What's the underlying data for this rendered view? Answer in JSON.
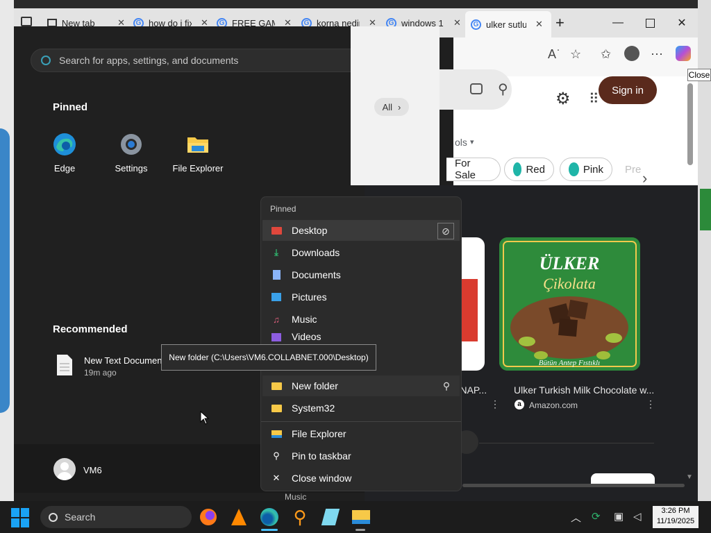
{
  "browser": {
    "tabs": [
      {
        "title": "New tab",
        "favicon": "newtab-icon"
      },
      {
        "title": "how do i fix",
        "favicon": "google-icon"
      },
      {
        "title": "FREE GAME",
        "favicon": "google-icon"
      },
      {
        "title": "korna nedir",
        "favicon": "google-icon"
      },
      {
        "title": "windows 1",
        "favicon": "google-icon"
      },
      {
        "title": "ulker sutlu",
        "favicon": "google-icon",
        "active": true
      }
    ],
    "close_tooltip": "Close"
  },
  "search_page": {
    "filter_all": "All",
    "tools_label": "ols",
    "signin_label": "Sign in",
    "chips": [
      {
        "label": "For Sale"
      },
      {
        "label": "Red",
        "color": "#1fb5a8"
      },
      {
        "label": "Pink",
        "color": "#1fb5a8"
      },
      {
        "label": "Pre"
      }
    ],
    "results": [
      {
        "caption": "A NAP...",
        "source": ""
      },
      {
        "caption": "Ulker Turkish Milk Chocolate w...",
        "source": "Amazon.com",
        "image_label": "ÜLKER",
        "image_sub": "Çikolata",
        "image_footer": "Bütün Antep Fıstıklı"
      }
    ]
  },
  "start_menu": {
    "search_placeholder": "Search for apps, settings, and documents",
    "pinned_heading": "Pinned",
    "pinned_apps": [
      {
        "label": "Edge",
        "icon": "edge-icon"
      },
      {
        "label": "Settings",
        "icon": "gear-icon"
      },
      {
        "label": "File Explorer",
        "icon": "folder-icon"
      }
    ],
    "recommended_heading": "Recommended",
    "recommended": [
      {
        "name": "New Text Document",
        "time": "19m ago"
      }
    ],
    "user_name": "VM6"
  },
  "jump_list": {
    "heading": "Pinned",
    "pinned": [
      {
        "label": "Desktop",
        "icon": "desktop-folder-icon",
        "color": "#e0473c"
      },
      {
        "label": "Downloads",
        "icon": "download-icon",
        "color": "#2fb36d"
      },
      {
        "label": "Documents",
        "icon": "document-icon",
        "color": "#8ab4f8"
      },
      {
        "label": "Pictures",
        "icon": "pictures-icon",
        "color": "#3aa0e8"
      },
      {
        "label": "Music",
        "icon": "music-icon",
        "color": "#e0607e"
      },
      {
        "label": "Videos",
        "icon": "video-icon",
        "color": "#8d5de0"
      }
    ],
    "recent": [
      {
        "label": "New folder",
        "icon": "folder-icon"
      },
      {
        "label": "System32",
        "icon": "folder-icon"
      }
    ],
    "actions": [
      {
        "label": "File Explorer",
        "icon": "file-explorer-icon"
      },
      {
        "label": "Pin to taskbar",
        "icon": "pin-icon"
      },
      {
        "label": "Close window",
        "icon": "close-icon"
      }
    ],
    "under_label": "Music",
    "tooltip": "New folder (C:\\Users\\VM6.COLLABNET.000\\Desktop)"
  },
  "taskbar": {
    "search_label": "Search",
    "time": "3:26 PM",
    "date": "11/19/2025"
  }
}
